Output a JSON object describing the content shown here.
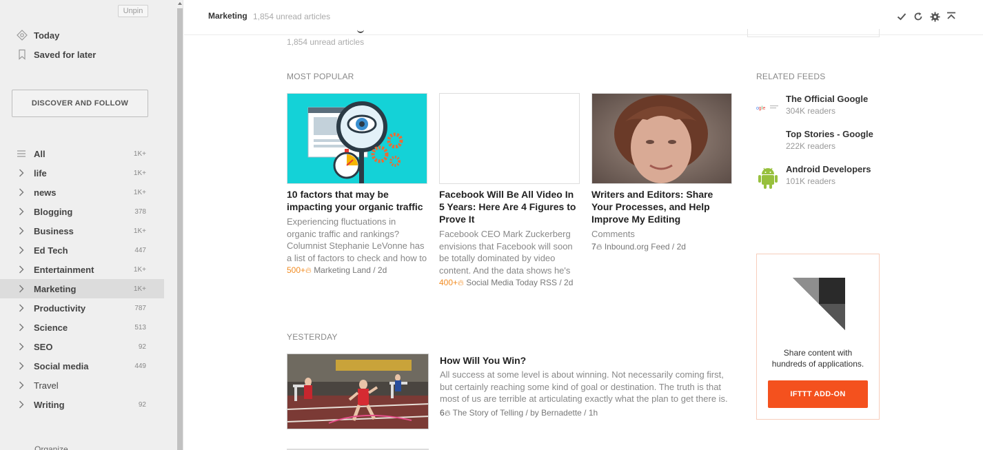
{
  "sidebar": {
    "unpin_label": "Unpin",
    "top_items": [
      {
        "label": "Today",
        "icon": "today-icon"
      },
      {
        "label": "Saved for later",
        "icon": "bookmark-icon"
      }
    ],
    "discover_label": "DISCOVER AND FOLLOW",
    "feeds": [
      {
        "label": "All",
        "count": "1K+",
        "icon": "list-icon",
        "bold": true
      },
      {
        "label": "life",
        "count": "1K+",
        "icon": "chevron-right-icon",
        "bold": true
      },
      {
        "label": "news",
        "count": "1K+",
        "icon": "chevron-right-icon",
        "bold": true
      },
      {
        "label": "Blogging",
        "count": "378",
        "icon": "chevron-right-icon",
        "bold": true
      },
      {
        "label": "Business",
        "count": "1K+",
        "icon": "chevron-right-icon",
        "bold": true
      },
      {
        "label": "Ed Tech",
        "count": "447",
        "icon": "chevron-right-icon",
        "bold": true
      },
      {
        "label": "Entertainment",
        "count": "1K+",
        "icon": "chevron-right-icon",
        "bold": true
      },
      {
        "label": "Marketing",
        "count": "1K+",
        "icon": "chevron-right-icon",
        "bold": true,
        "active": true
      },
      {
        "label": "Productivity",
        "count": "787",
        "icon": "chevron-right-icon",
        "bold": true
      },
      {
        "label": "Science",
        "count": "513",
        "icon": "chevron-right-icon",
        "bold": true
      },
      {
        "label": "SEO",
        "count": "92",
        "icon": "chevron-right-icon",
        "bold": true
      },
      {
        "label": "Social media",
        "count": "449",
        "icon": "chevron-right-icon",
        "bold": true
      },
      {
        "label": "Travel",
        "count": "",
        "icon": "chevron-right-icon",
        "bold": false
      },
      {
        "label": "Writing",
        "count": "92",
        "icon": "chevron-right-icon",
        "bold": true
      }
    ],
    "cut_text": "Organize"
  },
  "header": {
    "title": "Marketing",
    "subtitle": "1,854 unread articles",
    "actions": [
      "check-icon",
      "refresh-icon",
      "gear-icon",
      "collapse-top-icon"
    ]
  },
  "main": {
    "ghost_subtitle": "1,854 unread articles",
    "most_popular_label": "MOST POPULAR",
    "cards": [
      {
        "title": "10 factors that may be impacting your organic traffic",
        "summary": "Experiencing fluctuations in organic traffic and rankings? Columnist Stephanie LeVonne has a list of factors to check and how to",
        "engagement": "500+",
        "source": "Marketing Land / 2d"
      },
      {
        "title": "Facebook Will Be All Video In 5 Years: Here Are 4 Figures to Prove It",
        "summary": "Facebook CEO Mark Zuckerberg envisions that Facebook will soon be totally dominated by video content. And the data shows he's",
        "engagement": "400+",
        "source": "Social Media Today RSS / 2d"
      },
      {
        "title": "Writers and Editors: Share Your Processes, and Help Improve My Editing",
        "summary": "Comments",
        "engagement": "7",
        "source": "Inbound.org Feed / 2d"
      }
    ],
    "yesterday_label": "YESTERDAY",
    "yesterday": {
      "title": "How Will You Win?",
      "summary": "All success at some level is about winning. Not necessarily coming first, but certainly reaching some kind of goal or destination. The truth is that most of us are terrible at articulating exactly what the plan to get there is.",
      "engagement": "6",
      "source": "The Story of Telling / by Bernadette / 1h"
    }
  },
  "right": {
    "related_label": "RELATED FEEDS",
    "related": [
      {
        "name": "The Official Google",
        "readers": "304K readers",
        "logo": "google-logo-icon"
      },
      {
        "name": "Top Stories - Google",
        "readers": "222K readers",
        "logo": ""
      },
      {
        "name": "Android Developers",
        "readers": "101K readers",
        "logo": "android-icon"
      }
    ],
    "ifttt": {
      "text_line1": "Share content with",
      "text_line2": "hundreds of applications.",
      "button": "IFTTT ADD-ON"
    }
  },
  "colors": {
    "accent_orange": "#f28c22",
    "ifttt_red": "#f4511e",
    "sidebar_bg": "#efefef",
    "active_bg": "#dcdcdc"
  }
}
